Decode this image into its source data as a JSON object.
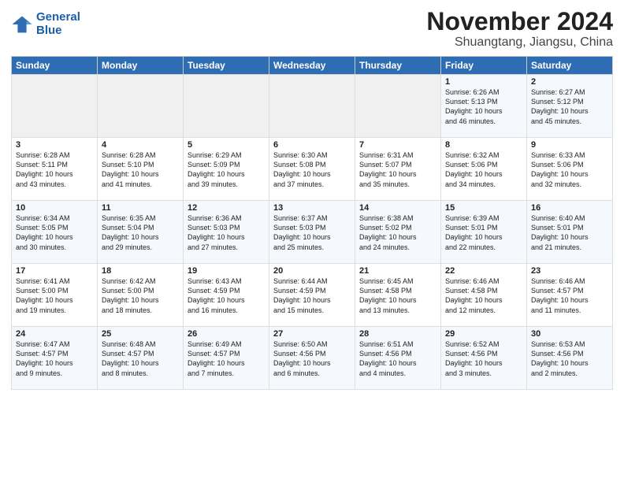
{
  "logo": {
    "line1": "General",
    "line2": "Blue"
  },
  "title": "November 2024",
  "location": "Shuangtang, Jiangsu, China",
  "days_header": [
    "Sunday",
    "Monday",
    "Tuesday",
    "Wednesday",
    "Thursday",
    "Friday",
    "Saturday"
  ],
  "weeks": [
    [
      {
        "day": "",
        "info": ""
      },
      {
        "day": "",
        "info": ""
      },
      {
        "day": "",
        "info": ""
      },
      {
        "day": "",
        "info": ""
      },
      {
        "day": "",
        "info": ""
      },
      {
        "day": "1",
        "info": "Sunrise: 6:26 AM\nSunset: 5:13 PM\nDaylight: 10 hours\nand 46 minutes."
      },
      {
        "day": "2",
        "info": "Sunrise: 6:27 AM\nSunset: 5:12 PM\nDaylight: 10 hours\nand 45 minutes."
      }
    ],
    [
      {
        "day": "3",
        "info": "Sunrise: 6:28 AM\nSunset: 5:11 PM\nDaylight: 10 hours\nand 43 minutes."
      },
      {
        "day": "4",
        "info": "Sunrise: 6:28 AM\nSunset: 5:10 PM\nDaylight: 10 hours\nand 41 minutes."
      },
      {
        "day": "5",
        "info": "Sunrise: 6:29 AM\nSunset: 5:09 PM\nDaylight: 10 hours\nand 39 minutes."
      },
      {
        "day": "6",
        "info": "Sunrise: 6:30 AM\nSunset: 5:08 PM\nDaylight: 10 hours\nand 37 minutes."
      },
      {
        "day": "7",
        "info": "Sunrise: 6:31 AM\nSunset: 5:07 PM\nDaylight: 10 hours\nand 35 minutes."
      },
      {
        "day": "8",
        "info": "Sunrise: 6:32 AM\nSunset: 5:06 PM\nDaylight: 10 hours\nand 34 minutes."
      },
      {
        "day": "9",
        "info": "Sunrise: 6:33 AM\nSunset: 5:06 PM\nDaylight: 10 hours\nand 32 minutes."
      }
    ],
    [
      {
        "day": "10",
        "info": "Sunrise: 6:34 AM\nSunset: 5:05 PM\nDaylight: 10 hours\nand 30 minutes."
      },
      {
        "day": "11",
        "info": "Sunrise: 6:35 AM\nSunset: 5:04 PM\nDaylight: 10 hours\nand 29 minutes."
      },
      {
        "day": "12",
        "info": "Sunrise: 6:36 AM\nSunset: 5:03 PM\nDaylight: 10 hours\nand 27 minutes."
      },
      {
        "day": "13",
        "info": "Sunrise: 6:37 AM\nSunset: 5:03 PM\nDaylight: 10 hours\nand 25 minutes."
      },
      {
        "day": "14",
        "info": "Sunrise: 6:38 AM\nSunset: 5:02 PM\nDaylight: 10 hours\nand 24 minutes."
      },
      {
        "day": "15",
        "info": "Sunrise: 6:39 AM\nSunset: 5:01 PM\nDaylight: 10 hours\nand 22 minutes."
      },
      {
        "day": "16",
        "info": "Sunrise: 6:40 AM\nSunset: 5:01 PM\nDaylight: 10 hours\nand 21 minutes."
      }
    ],
    [
      {
        "day": "17",
        "info": "Sunrise: 6:41 AM\nSunset: 5:00 PM\nDaylight: 10 hours\nand 19 minutes."
      },
      {
        "day": "18",
        "info": "Sunrise: 6:42 AM\nSunset: 5:00 PM\nDaylight: 10 hours\nand 18 minutes."
      },
      {
        "day": "19",
        "info": "Sunrise: 6:43 AM\nSunset: 4:59 PM\nDaylight: 10 hours\nand 16 minutes."
      },
      {
        "day": "20",
        "info": "Sunrise: 6:44 AM\nSunset: 4:59 PM\nDaylight: 10 hours\nand 15 minutes."
      },
      {
        "day": "21",
        "info": "Sunrise: 6:45 AM\nSunset: 4:58 PM\nDaylight: 10 hours\nand 13 minutes."
      },
      {
        "day": "22",
        "info": "Sunrise: 6:46 AM\nSunset: 4:58 PM\nDaylight: 10 hours\nand 12 minutes."
      },
      {
        "day": "23",
        "info": "Sunrise: 6:46 AM\nSunset: 4:57 PM\nDaylight: 10 hours\nand 11 minutes."
      }
    ],
    [
      {
        "day": "24",
        "info": "Sunrise: 6:47 AM\nSunset: 4:57 PM\nDaylight: 10 hours\nand 9 minutes."
      },
      {
        "day": "25",
        "info": "Sunrise: 6:48 AM\nSunset: 4:57 PM\nDaylight: 10 hours\nand 8 minutes."
      },
      {
        "day": "26",
        "info": "Sunrise: 6:49 AM\nSunset: 4:57 PM\nDaylight: 10 hours\nand 7 minutes."
      },
      {
        "day": "27",
        "info": "Sunrise: 6:50 AM\nSunset: 4:56 PM\nDaylight: 10 hours\nand 6 minutes."
      },
      {
        "day": "28",
        "info": "Sunrise: 6:51 AM\nSunset: 4:56 PM\nDaylight: 10 hours\nand 4 minutes."
      },
      {
        "day": "29",
        "info": "Sunrise: 6:52 AM\nSunset: 4:56 PM\nDaylight: 10 hours\nand 3 minutes."
      },
      {
        "day": "30",
        "info": "Sunrise: 6:53 AM\nSunset: 4:56 PM\nDaylight: 10 hours\nand 2 minutes."
      }
    ]
  ]
}
